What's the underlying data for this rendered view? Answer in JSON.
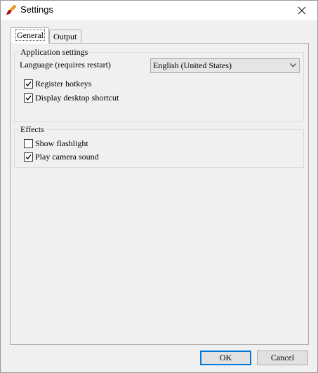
{
  "window": {
    "title": "Settings"
  },
  "tabs": [
    {
      "label": "General",
      "selected": true
    },
    {
      "label": "Output",
      "selected": false
    }
  ],
  "application_settings": {
    "caption": "Application settings",
    "language_label": "Language (requires restart)",
    "language_value": "English (United States)",
    "register_hotkeys": {
      "label": "Register hotkeys",
      "checked": true
    },
    "display_desktop_shortcut": {
      "label": "Display desktop shortcut",
      "checked": true
    }
  },
  "effects": {
    "caption": "Effects",
    "show_flashlight": {
      "label": "Show flashlight",
      "checked": false
    },
    "play_camera_sound": {
      "label": "Play camera sound",
      "checked": true
    }
  },
  "buttons": {
    "ok": "OK",
    "cancel": "Cancel"
  },
  "icons": {
    "app": "paintbrush-icon",
    "close": "close-icon",
    "dropdown": "chevron-down-icon",
    "check": "checkmark-icon"
  }
}
